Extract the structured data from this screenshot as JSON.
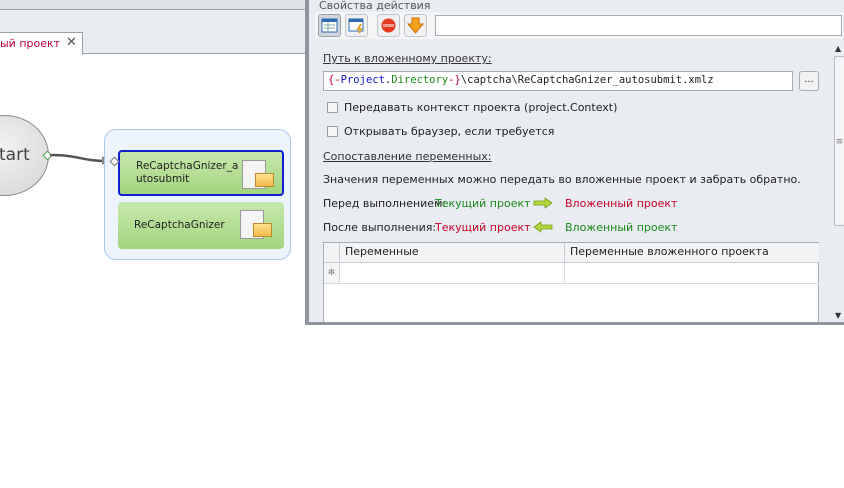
{
  "tab": {
    "title": "ый проект",
    "close": "✕"
  },
  "canvas": {
    "start_label": "tart",
    "nodes": [
      {
        "label": "ReCaptchaGnizer_autosubmit",
        "selected": true
      },
      {
        "label": "ReCaptchaGnizer",
        "selected": false
      }
    ]
  },
  "panel": {
    "title": "Свойства действия",
    "toolbar": {
      "search_value": ""
    },
    "path_label": "Путь к вложенному проекту:",
    "path": {
      "macro_open": "{-",
      "macro_project": "Project",
      "dot": ".",
      "macro_directory": "Directory",
      "macro_close": "-}",
      "rest": "\\captcha\\ReCaptchaGnizer_autosubmit.xmlz"
    },
    "browse_label": "...",
    "checkbox_context": "Передавать контекст проекта (project.Context)",
    "checkbox_browser": "Открывать браузер, если требуется",
    "mapping_label": "Сопоставление переменных:",
    "mapping_desc": "Значения переменных можно передать во вложенные проект и забрать обратно.",
    "before_label": "Перед выполнением:",
    "after_label": "После выполнения:",
    "current_project": "Текущий проект",
    "nested_project": "Вложенный проект",
    "grid": {
      "columns": [
        "Переменные",
        "Переменные вложенного проекта"
      ],
      "new_row_marker": "✻"
    }
  }
}
